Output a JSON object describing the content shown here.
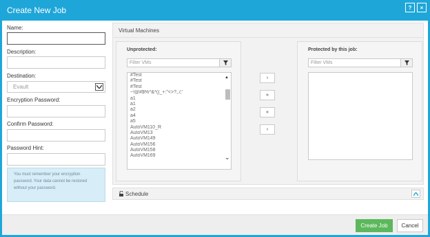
{
  "window": {
    "title": "Create New Job",
    "help_label": "?",
    "close_label": "×"
  },
  "form": {
    "name_label": "Name:",
    "description_label": "Description:",
    "destination_label": "Destination:",
    "destination_value": "Evault",
    "encryption_label": "Encryption Password:",
    "confirm_label": "Confirm Password:",
    "hint_label": "Password Hint:",
    "info_text": "You must remember your encryption password. Your data cannot be restored without your password."
  },
  "vm": {
    "section_title": "Virtual Machines",
    "unprotected": {
      "title": "Unprotected:",
      "filter_placeholder": "Filter VMs",
      "items": [
        "#Test",
        "#Test",
        "#Test",
        "~!@#$%^&*()_+:\"<>?,./;'",
        "a1",
        "a1",
        "a2",
        "a4",
        "a5",
        "AutoVM110_R",
        "AutoVM13",
        "AutoVM149",
        "AutoVM156",
        "AutoVM158",
        "AutoVM169"
      ]
    },
    "protected": {
      "title": "Protected by this job:",
      "filter_placeholder": "Filter VMs"
    },
    "move_buttons": {
      "add_one": "›",
      "add_all": "»",
      "remove_all": "«",
      "remove_one": "‹"
    }
  },
  "schedule": {
    "label": "Schedule",
    "toggle": "^"
  },
  "footer": {
    "create_label": "Create Job",
    "cancel_label": "Cancel"
  },
  "colors": {
    "accent": "#1fa6d9",
    "create": "#5cb85c",
    "info_bg": "#d7edf7"
  }
}
